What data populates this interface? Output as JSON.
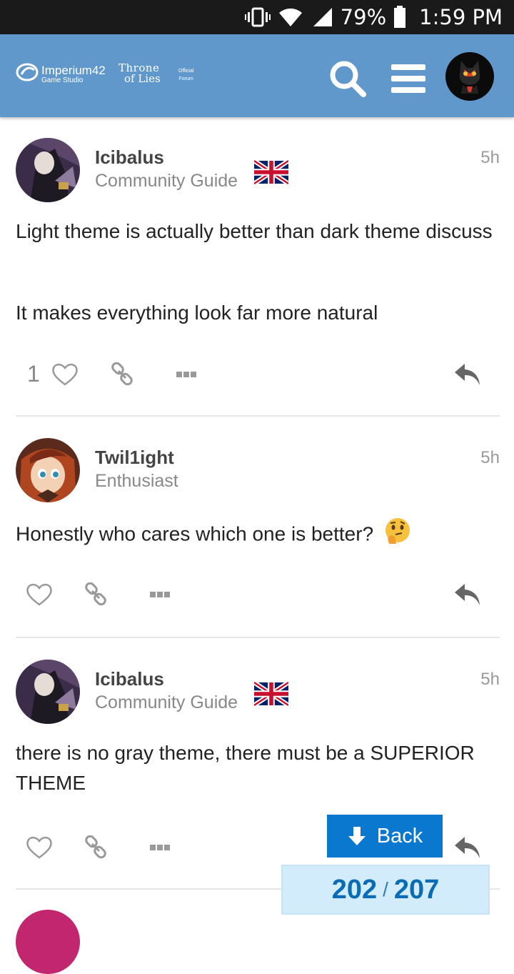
{
  "status_bar": {
    "battery": "79%",
    "time": "1:59 PM"
  },
  "header": {
    "logo_main": "Imperium42",
    "logo_sub": "Game Studio",
    "logo2_line1": "Throne",
    "logo2_line2": "of Lies",
    "logo3_line1": "Official",
    "logo3_line2": "Forum"
  },
  "posts": [
    {
      "username": "Icibalus",
      "user_title": "Community Guide",
      "time": "5h",
      "paragraphs": [
        "Light theme is actually better than dark theme discuss",
        "It makes everything look far more natural"
      ],
      "like_count": "1"
    },
    {
      "username": "Twil1ight",
      "user_title": "Enthusiast",
      "time": "5h",
      "paragraphs": [
        "Honestly who cares which one is better?"
      ]
    },
    {
      "username": "Icibalus",
      "user_title": "Community Guide",
      "time": "5h",
      "paragraphs": [
        "there is no gray theme, there must be a SUPERIOR THEME"
      ]
    }
  ],
  "back_button": {
    "label": "Back"
  },
  "progress": {
    "current": "202",
    "separator": "/",
    "total": "207"
  },
  "colors": {
    "header": "#6198cc",
    "accent": "#0b78cf",
    "progress_bg": "#d2ecfb"
  }
}
